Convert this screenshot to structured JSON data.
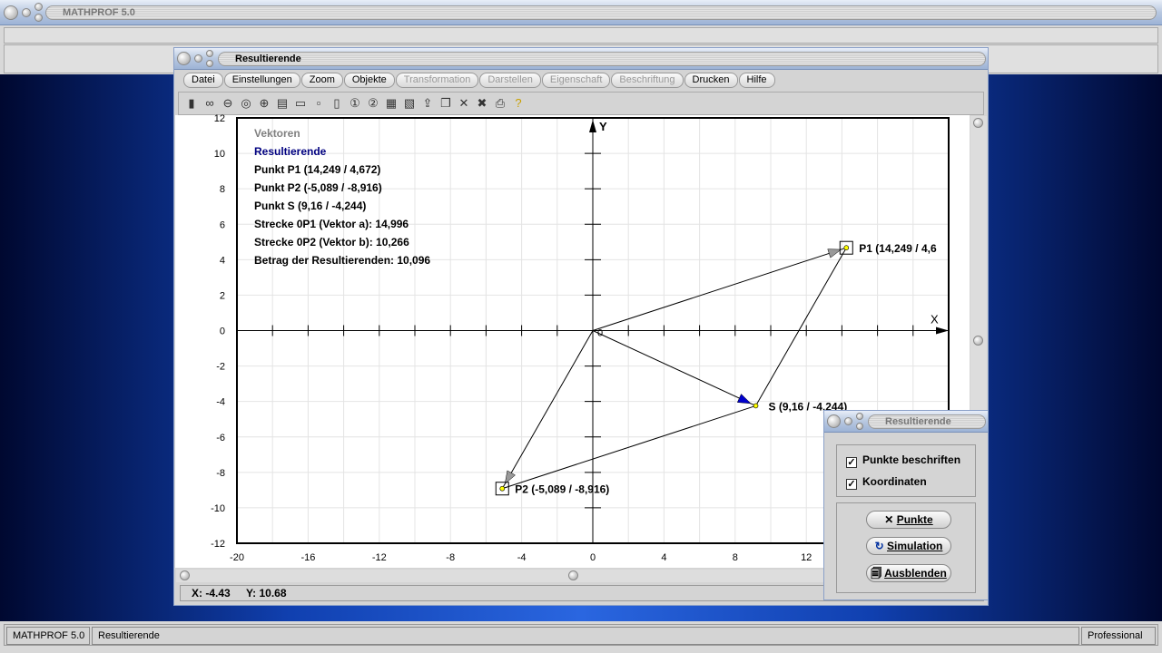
{
  "app": {
    "title": "MATHPROF 5.0"
  },
  "window": {
    "title": "Resultierende",
    "menu": [
      {
        "label": "Datei",
        "enabled": true
      },
      {
        "label": "Einstellungen",
        "enabled": true
      },
      {
        "label": "Zoom",
        "enabled": true
      },
      {
        "label": "Objekte",
        "enabled": true
      },
      {
        "label": "Transformation",
        "enabled": false
      },
      {
        "label": "Darstellen",
        "enabled": false
      },
      {
        "label": "Eigenschaft",
        "enabled": false
      },
      {
        "label": "Beschriftung",
        "enabled": false
      },
      {
        "label": "Drucken",
        "enabled": true
      },
      {
        "label": "Hilfe",
        "enabled": true
      }
    ],
    "toolbar": [
      "panel-icon",
      "glasses-icon",
      "zoom-out-icon",
      "zoom-reset-icon",
      "zoom-in-icon",
      "properties-icon",
      "window-icon",
      "box-icon",
      "dual-box-icon",
      "circle-1-icon",
      "circle-2-icon",
      "table-icon",
      "image-icon",
      "export-icon",
      "copy-icon",
      "delete-icon",
      "delete-all-icon",
      "print-icon",
      "help-icon"
    ],
    "coords": {
      "x": "X: -4.43",
      "y": "Y: 10.68"
    }
  },
  "info": {
    "heading": "Vektoren",
    "subheading": "Resultierende",
    "lines": [
      "Punkt P1 (14,249 / 4,672)",
      "Punkt P2 (-5,089 / -8,916)",
      "Punkt S (9,16 / -4,244)",
      "Strecke 0P1 (Vektor a): 14,996",
      "Strecke 0P2 (Vektor b): 10,266",
      "Betrag der Resultierenden: 10,096"
    ]
  },
  "plot": {
    "xlim": [
      -20,
      20
    ],
    "ylim": [
      -12,
      12
    ],
    "x_ticks": [
      -20,
      -16,
      -12,
      -8,
      -4,
      0,
      4,
      8,
      12
    ],
    "y_ticks": [
      12,
      10,
      8,
      6,
      4,
      2,
      0,
      -2,
      -4,
      -6,
      -8,
      -10,
      -12
    ],
    "x_label": "X",
    "y_label": "Y",
    "origin_label": "0",
    "grid": true,
    "points": [
      {
        "name": "P1",
        "x": 14.249,
        "y": 4.672,
        "label": "P1 (14,249 / 4,6"
      },
      {
        "name": "P2",
        "x": -5.089,
        "y": -8.916,
        "label": "P2 (-5,089 / -8,916)"
      },
      {
        "name": "S",
        "x": 9.16,
        "y": -4.244,
        "label": "S (9,16 / -4,244)"
      }
    ],
    "colors": {
      "resultant_arrow": "#0000cc",
      "heading": "#808080",
      "subheading": "#000080"
    }
  },
  "panel": {
    "title": "Resultierende",
    "checkboxes": [
      {
        "label": "Punkte beschriften",
        "checked": true
      },
      {
        "label": "Koordinaten",
        "checked": true
      }
    ],
    "buttons": [
      "Punkte",
      "Simulation",
      "Ausblenden"
    ]
  },
  "statusbar": {
    "app": "MATHPROF 5.0",
    "doc": "Resultierende",
    "edition": "Professional"
  }
}
